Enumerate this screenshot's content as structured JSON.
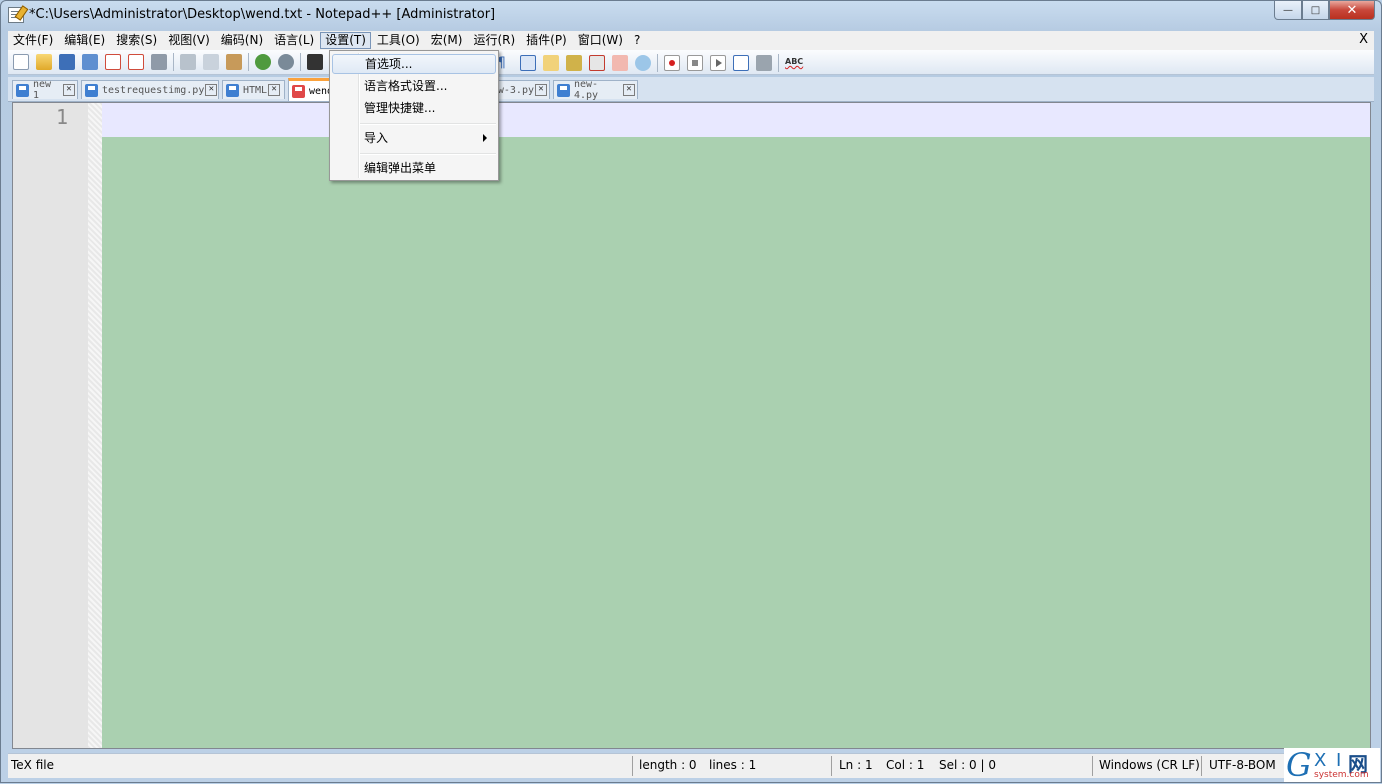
{
  "window": {
    "title": "*C:\\Users\\Administrator\\Desktop\\wend.txt - Notepad++ [Administrator]",
    "minimize_glyph": "—",
    "maximize_glyph": "□",
    "close_glyph": "✕"
  },
  "menubar": {
    "items": [
      "文件(F)",
      "编辑(E)",
      "搜索(S)",
      "视图(V)",
      "编码(N)",
      "语言(L)",
      "设置(T)",
      "工具(O)",
      "宏(M)",
      "运行(R)",
      "插件(P)",
      "窗口(W)",
      "?"
    ],
    "active_index": 6,
    "close_label": "X"
  },
  "toolbar": {
    "icons": [
      "new-file-icon",
      "open-file-icon",
      "save-icon",
      "save-all-icon",
      "close-file-icon",
      "close-all-icon",
      "print-icon",
      "cut-icon",
      "copy-icon",
      "paste-icon",
      "undo-icon",
      "redo-icon",
      "find-icon",
      "show-all-chars-icon",
      "indent-guide-icon",
      "word-wrap-icon",
      "user-lang-icon",
      "doc-map-icon",
      "function-list-icon",
      "folder-workspace-icon",
      "monitor-icon",
      "record-macro-icon",
      "stop-macro-icon",
      "play-macro-icon",
      "run-macro-multiple-icon",
      "save-macro-icon",
      "spell-check-icon"
    ],
    "spell_check_label": "ABC"
  },
  "tabs": [
    {
      "label": "new 1",
      "active": false,
      "icon": "file-saved-icon"
    },
    {
      "label": "testrequestimg.py",
      "active": false,
      "icon": "file-saved-icon"
    },
    {
      "label": "HTML",
      "active": false,
      "icon": "file-saved-icon"
    },
    {
      "label": "wend.txt",
      "active": true,
      "icon": "file-unsaved-icon"
    },
    {
      "label": "new-3.py",
      "active": false,
      "icon": "file-saved-icon"
    },
    {
      "label": "new-4.py",
      "active": false,
      "icon": "file-saved-icon"
    }
  ],
  "editor": {
    "line_numbers": [
      "1"
    ],
    "content": "",
    "background_color": "#aad0b0",
    "current_line_color": "#e8e8ff"
  },
  "settings_menu": {
    "items": [
      {
        "label": "首选项...",
        "hovered": true,
        "submenu": false
      },
      {
        "label": "语言格式设置...",
        "hovered": false,
        "submenu": false
      },
      {
        "label": "管理快捷键...",
        "hovered": false,
        "submenu": false
      },
      {
        "label": "导入",
        "hovered": false,
        "submenu": true
      },
      {
        "label": "编辑弹出菜单",
        "hovered": false,
        "submenu": false
      }
    ]
  },
  "statusbar": {
    "file_type": "TeX file",
    "length": "length : 0",
    "lines": "lines : 1",
    "ln": "Ln : 1",
    "col": "Col : 1",
    "sel": "Sel : 0 | 0",
    "eol": "Windows (CR LF)",
    "encoding": "UTF-8-BOM"
  },
  "watermark": {
    "brand_g": "G",
    "brand_xi": "X I",
    "brand_wang": "网",
    "url": "system.com"
  }
}
